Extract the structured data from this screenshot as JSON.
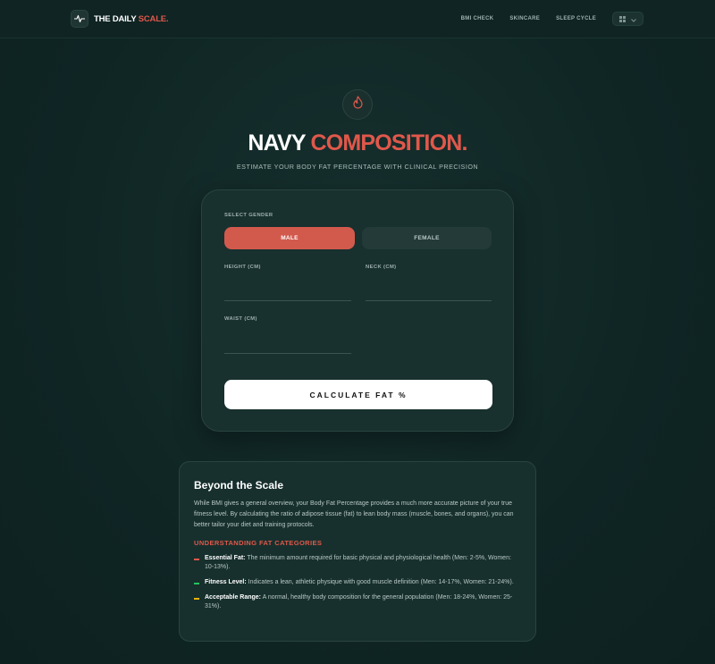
{
  "brand": {
    "prefix": "THE DAILY",
    "accent": "SCALE."
  },
  "nav": {
    "links": [
      "BMI CHECK",
      "SKINCARE",
      "SLEEP CYCLE"
    ]
  },
  "hero": {
    "title_white": "NAVY",
    "title_accent": "COMPOSITION.",
    "subtitle": "ESTIMATE YOUR BODY FAT PERCENTAGE WITH CLINICAL PRECISION"
  },
  "form": {
    "gender_label": "SELECT GENDER",
    "male": "MALE",
    "female": "FEMALE",
    "selected_gender": "MALE",
    "height_label": "HEIGHT (CM)",
    "neck_label": "NECK (CM)",
    "waist_label": "WAIST (CM)",
    "height_value": "",
    "neck_value": "",
    "waist_value": "",
    "submit": "CALCULATE FAT %"
  },
  "info": {
    "title": "Beyond the Scale",
    "body": "While BMI gives a general overview, your Body Fat Percentage provides a much more accurate picture of your true fitness level. By calculating the ratio of adipose tissue (fat) to lean body mass (muscle, bones, and organs), you can better tailor your diet and training protocols.",
    "categories_heading": "UNDERSTANDING FAT CATEGORIES",
    "categories": [
      {
        "name": "Essential Fat:",
        "desc": "The minimum amount required for basic physical and physiological health (Men: 2-5%, Women: 10-13%).",
        "color": "#e0584b"
      },
      {
        "name": "Fitness Level:",
        "desc": "Indicates a lean, athletic physique with good muscle definition (Men: 14-17%, Women: 21-24%).",
        "color": "#22c55e"
      },
      {
        "name": "Acceptable Range:",
        "desc": "A normal, healthy body composition for the general population (Men: 18-24%, Women: 25-31%).",
        "color": "#eab308"
      }
    ]
  },
  "colors": {
    "accent": "#e0584b",
    "background": "#0f2524",
    "card": "#18302e"
  },
  "icons": {
    "brand": "heartbeat-icon",
    "hero": "flame-icon",
    "apps": "grid-icon",
    "dropdown": "chevron-down-icon"
  }
}
